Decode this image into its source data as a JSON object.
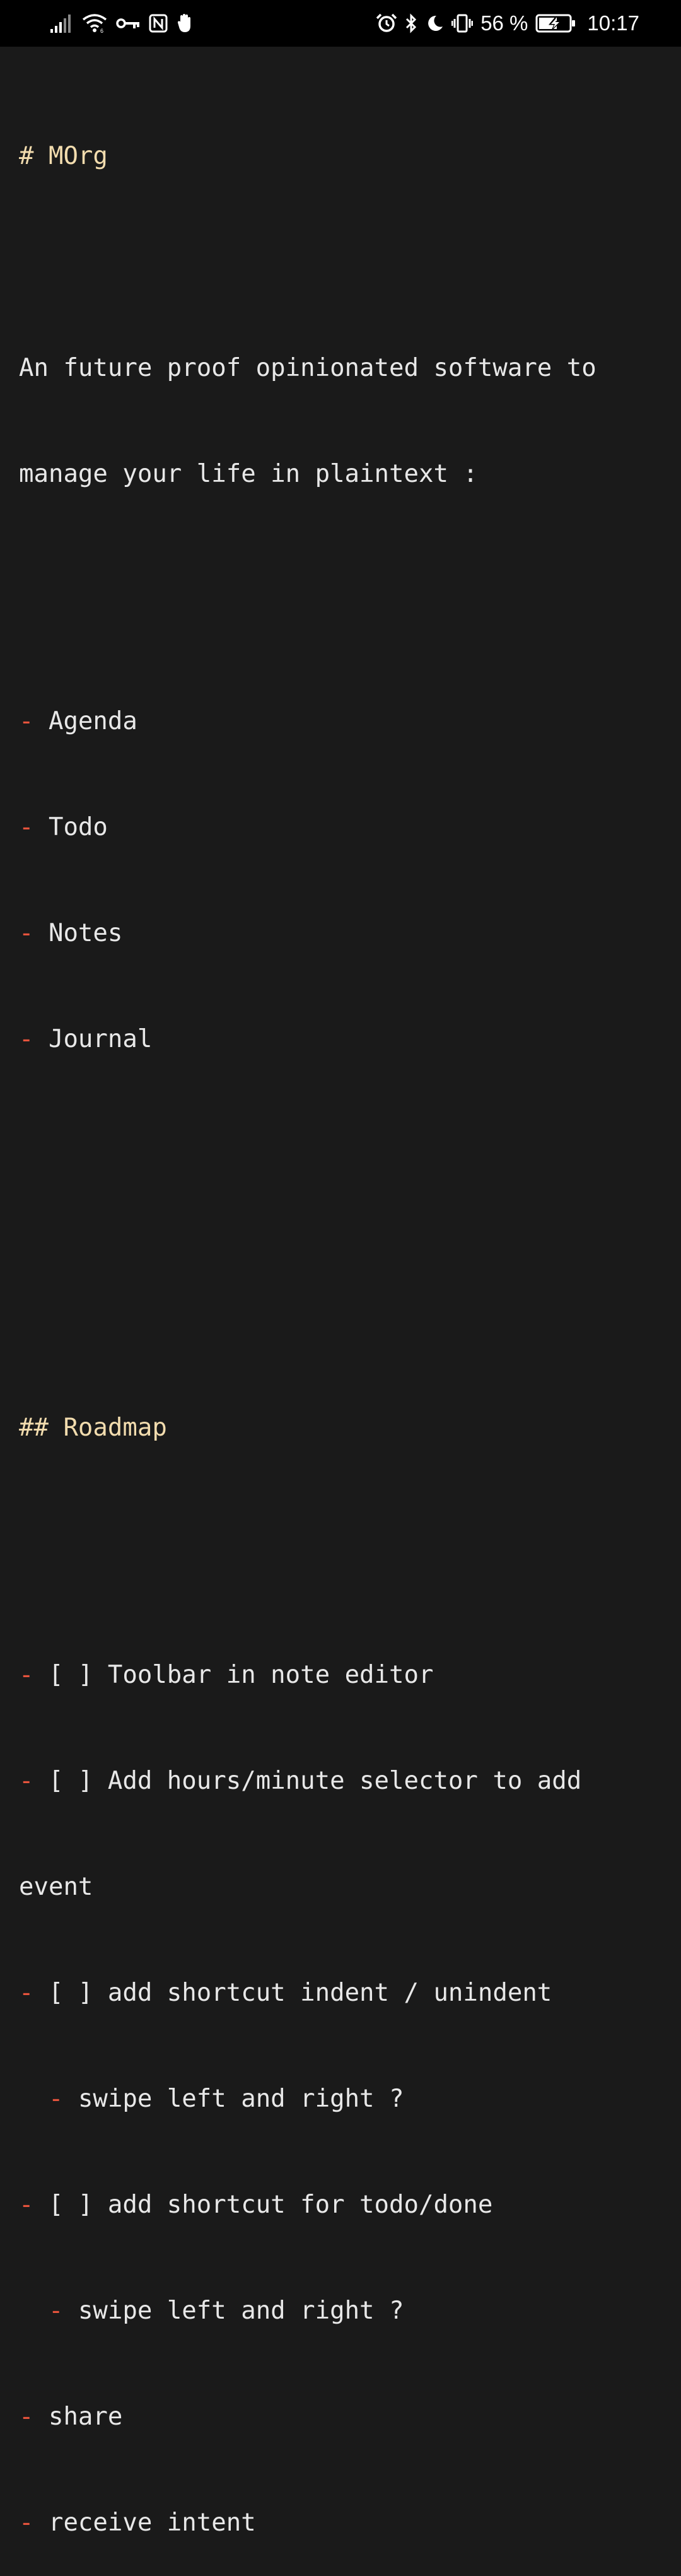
{
  "status_bar": {
    "battery_percent": "56 %",
    "time": "10:17",
    "left_icons": [
      "signal-icon",
      "wifi-icon",
      "vpn-key-icon",
      "nfc-icon",
      "notification-hand-icon"
    ],
    "right_icons": [
      "alarm-icon",
      "bluetooth-icon",
      "do-not-disturb-moon-icon",
      "vibrate-icon",
      "battery-charging-icon"
    ]
  },
  "colors": {
    "background": "#1a1a1a",
    "text": "#e8e8e8",
    "heading": "#f2dcae",
    "bullet": "#e5533c"
  },
  "note": {
    "title": "# MOrg",
    "intro_line1": "An future proof opinionated software to",
    "intro_line2": "manage your life in plaintext :",
    "features": [
      "Agenda",
      "Todo",
      "Notes",
      "Journal"
    ],
    "roadmap_heading": "## Roadmap",
    "roadmap": {
      "item1": "[ ] Toolbar in note editor",
      "item2_line1": "[ ] Add hours/minute selector to add",
      "item2_line2": "event",
      "item3": "[ ] add shortcut indent / unindent",
      "item3_sub": "swipe left and right ?",
      "item4": "[ ] add shortcut for todo/done",
      "item4_sub": "swipe left and right ?",
      "item5": "share",
      "item6": "receive intent"
    },
    "bullet": "-"
  }
}
